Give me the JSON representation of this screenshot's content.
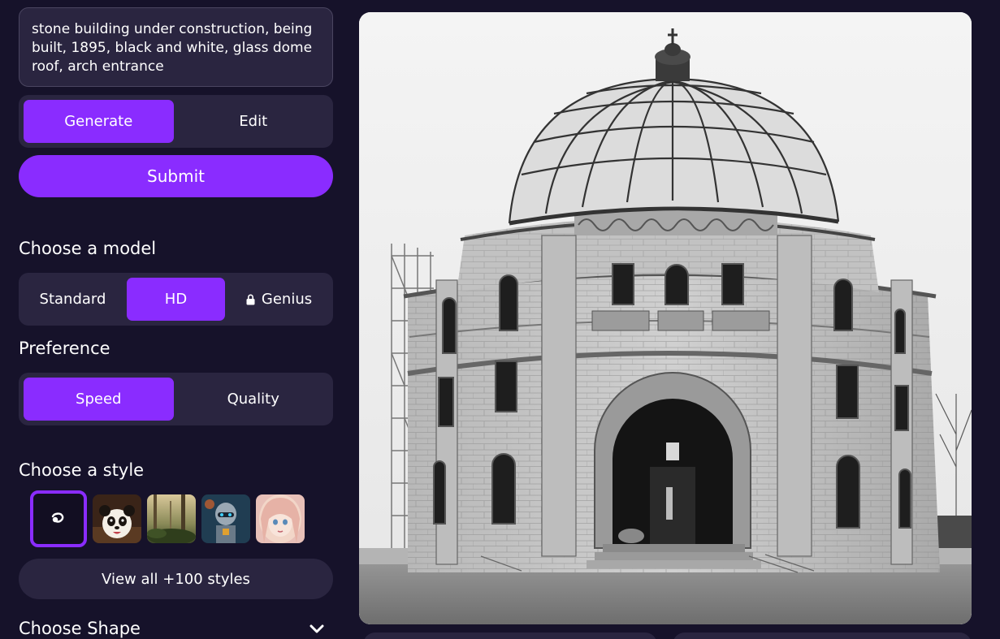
{
  "prompt": {
    "text": "stone building under construction, being built, 1895, black and white, glass dome roof, arch entrance"
  },
  "mode_tabs": [
    {
      "label": "Generate",
      "active": true
    },
    {
      "label": "Edit",
      "active": false
    }
  ],
  "submit_label": "Submit",
  "model": {
    "title": "Choose a model",
    "options": [
      {
        "label": "Standard",
        "active": false,
        "locked": false
      },
      {
        "label": "HD",
        "active": true,
        "locked": false
      },
      {
        "label": "Genius",
        "active": false,
        "locked": true
      }
    ]
  },
  "preference": {
    "title": "Preference",
    "options": [
      {
        "label": "Speed",
        "active": true
      },
      {
        "label": "Quality",
        "active": false
      }
    ]
  },
  "style": {
    "title": "Choose a style",
    "thumbs": [
      "no-style-icon",
      "panda",
      "forest",
      "robot",
      "anime-girl"
    ],
    "view_all_label": "View all +100 styles"
  },
  "shape": {
    "title": "Choose Shape",
    "icon": "chevron-down-icon"
  },
  "colors": {
    "accent": "#8a2cff",
    "background": "#16122a",
    "panel": "#2a2540"
  }
}
